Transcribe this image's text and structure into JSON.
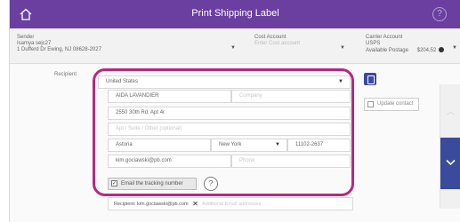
{
  "header": {
    "title": "Print Shipping Label",
    "home_icon": "home-icon",
    "help_icon": "help-icon",
    "help_glyph": "?"
  },
  "sender": {
    "label": "Sender",
    "name": "Isamya sejc27",
    "address": "1 Dufferd Dr Ewing, NJ 08628-2027",
    "caret": "▼"
  },
  "cost_account": {
    "label": "Cost Account",
    "placeholder": "Enter Cost account",
    "caret": "▼"
  },
  "carrier_account": {
    "label": "Carrier Account",
    "carrier": "USPS",
    "postage_label": "Available Postage",
    "postage_value": "$204.52",
    "caret": "▼"
  },
  "recipient": {
    "label": "Recipient",
    "country": "United States",
    "country_caret": "▼",
    "name": "AIDA LAVANDIER",
    "company_placeholder": "Company",
    "address1": "2550 30th Rd. Apt 4r",
    "address2_placeholder": "Apt / Suite / Other (optional)",
    "city": "Astoria",
    "state": "New York",
    "state_caret": "▼",
    "zip": "11102-2637",
    "email": "kim.gociawski@pb.com",
    "phone_placeholder": "Phone"
  },
  "update_contact_label": "Update contact",
  "email_tracking": {
    "label": "Email the tracking number",
    "checked_glyph": "✓",
    "info_glyph": "?"
  },
  "tracking_recipients": {
    "chip_text": "Recipient: kim.gociawski@pb.com",
    "remove_glyph": "✕",
    "placeholder": "Additional Email addresses"
  },
  "side_panel": {
    "up_glyph": "︿"
  },
  "colors": {
    "header_purple": "#6a3fa0",
    "highlight_magenta": "#b8287e",
    "action_blue": "#3a4a9c"
  }
}
